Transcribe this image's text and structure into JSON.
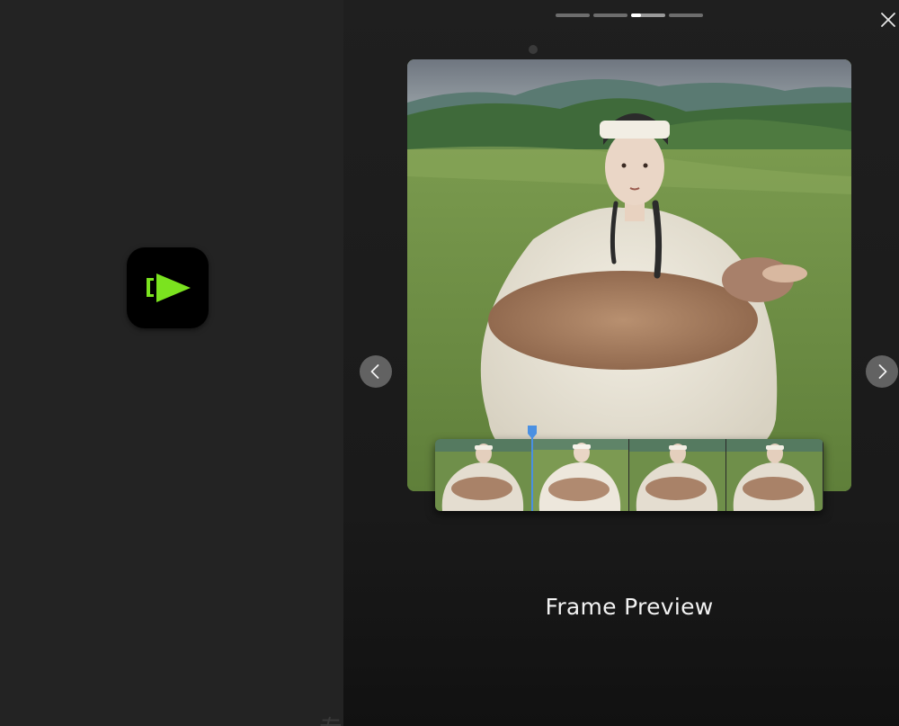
{
  "app": {
    "icon": "play-logo-icon",
    "accent_color": "#7be31f"
  },
  "pager": {
    "total": 4,
    "active_index": 2
  },
  "close": {
    "icon": "close-icon"
  },
  "carousel": {
    "prev_icon": "chevron-left-icon",
    "next_icon": "chevron-right-icon"
  },
  "slide": {
    "title": "Frame Preview",
    "frames_count": 4,
    "playhead_color": "#4a90e2"
  },
  "watermark": "专业剪辑"
}
